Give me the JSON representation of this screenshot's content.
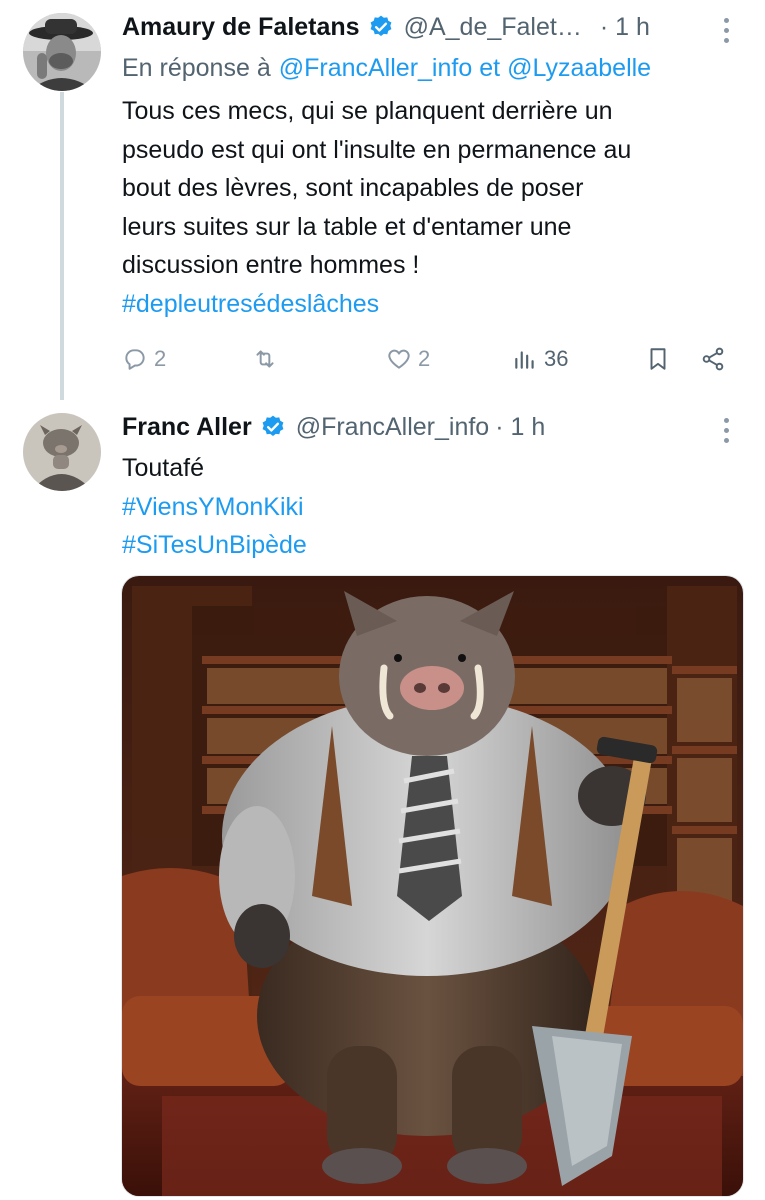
{
  "tweets": [
    {
      "author": "Amaury de Faletans",
      "handle": "@A_de_Falet…",
      "time": "· 1 h",
      "reply_prefix": "En réponse à",
      "reply_to_1": "@FrancAller_info",
      "reply_and": "et",
      "reply_to_2": "@Lyzaabelle",
      "text_lines": [
        "Tous ces mecs, qui se planquent derrière un",
        "pseudo est qui ont l'insulte en permanence au",
        "bout des lèvres, sont incapables de poser",
        "leurs suites sur la table et d'entamer une",
        "discussion entre hommes !"
      ],
      "hashtag": "#depleutresédeslâches",
      "replies": "2",
      "likes": "2",
      "views": "36"
    },
    {
      "author": "Franc Aller",
      "handle": "@FrancAller_info",
      "time": "· 1 h",
      "text": "Toutafé",
      "hashtags": [
        "#ViensYMonKiki",
        "#SiTesUnBipède"
      ]
    }
  ],
  "icons": {
    "verified": "verified-badge-icon",
    "more": "more-vertical-icon",
    "reply": "reply-icon",
    "retweet": "retweet-icon",
    "like": "heart-icon",
    "views": "views-bar-chart-icon",
    "bookmark": "bookmark-icon",
    "share": "share-icon"
  },
  "colors": {
    "link": "#1d9bf0",
    "verified": "#1d9bf0",
    "muted": "#536471",
    "text": "#0f1419"
  }
}
